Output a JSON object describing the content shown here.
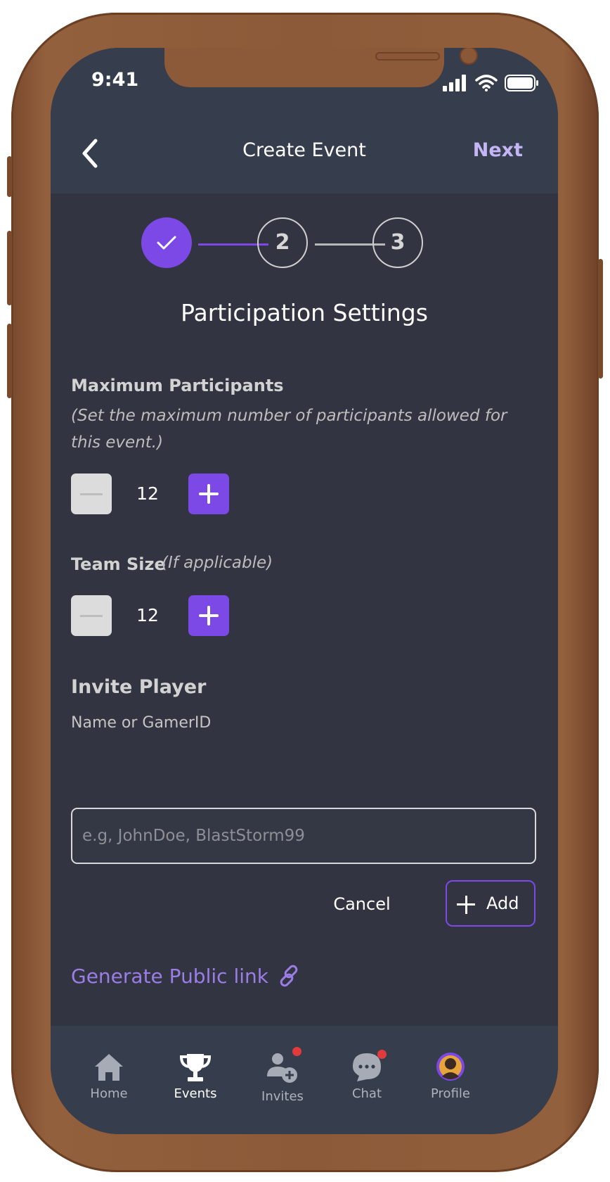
{
  "status_bar": {
    "time": "9:41"
  },
  "header": {
    "title": "Create Event",
    "next_label": "Next"
  },
  "stepper": {
    "steps": [
      "",
      "2",
      "3"
    ],
    "completed": 1
  },
  "section_title": "Participation Settings",
  "max_participants": {
    "label": "Maximum Participants",
    "hint": "(Set the maximum number of participants allowed for this event.)",
    "value": "12"
  },
  "team_size": {
    "label": "Team Size",
    "hint": "(If applicable)",
    "value": "12"
  },
  "invite": {
    "title": "Invite Player",
    "field_label": "Name or GamerID",
    "placeholder": "e.g, JohnDoe, BlastStorm99",
    "cancel_label": "Cancel",
    "add_label": "Add"
  },
  "public_link_label": "Generate Public link",
  "tabbar": {
    "items": [
      {
        "label": "Home",
        "icon": "home-icon"
      },
      {
        "label": "Events",
        "icon": "trophy-icon",
        "active": true
      },
      {
        "label": "Invites",
        "icon": "add-user-icon",
        "badge": true
      },
      {
        "label": "Chat",
        "icon": "chat-icon",
        "badge": true
      },
      {
        "label": "Profile",
        "icon": "avatar"
      }
    ]
  },
  "colors": {
    "accent": "#7c48e6",
    "accent_light": "#9b7de6",
    "background": "#323541",
    "header": "#363d4c",
    "badge": "#e33b3b",
    "device_frame": "#8c5a38"
  }
}
